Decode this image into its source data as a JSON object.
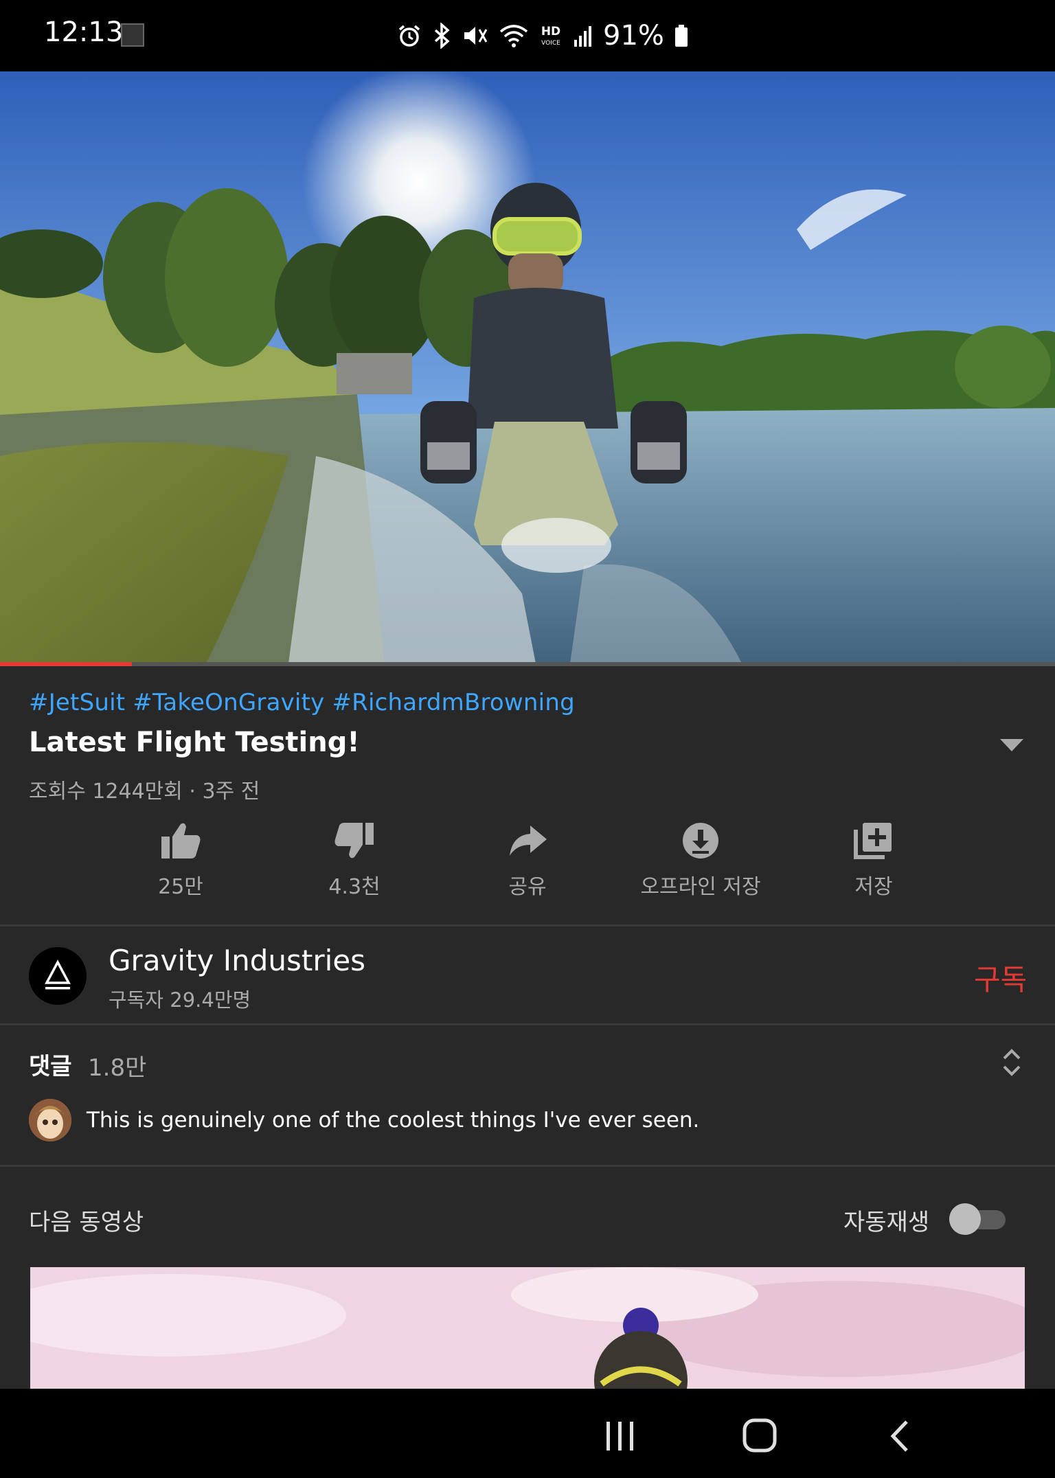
{
  "status_bar": {
    "time": "12:13",
    "battery": "91%",
    "icons": [
      "alarm-icon",
      "bluetooth-icon",
      "mute-icon",
      "wifi-icon",
      "hd-voice-icon",
      "signal-icon",
      "battery-icon"
    ],
    "hd_voice_top": "HD",
    "hd_voice_bottom": "VOICE"
  },
  "player": {
    "progress_fraction": 0.125,
    "progress_color": "#e53935"
  },
  "video": {
    "hashtags": "#JetSuit #TakeOnGravity #RichardmBrowning",
    "title": "Latest Flight Testing!",
    "meta": "조회수 1244만회 · 3주 전"
  },
  "actions": [
    {
      "icon": "thumbs-up-icon",
      "label": "25만"
    },
    {
      "icon": "thumbs-down-icon",
      "label": "4.3천"
    },
    {
      "icon": "share-icon",
      "label": "공유"
    },
    {
      "icon": "download-icon",
      "label": "오프라인 저장"
    },
    {
      "icon": "add-to-playlist-icon",
      "label": "저장"
    }
  ],
  "channel": {
    "name": "Gravity Industries",
    "subscribers": "구독자 29.4만명",
    "subscribe_label": "구독",
    "subscribe_color": "#e53935"
  },
  "comments": {
    "label": "댓글",
    "count": "1.8만",
    "top_comment": "This is genuinely one of the coolest things I've ever seen."
  },
  "up_next": {
    "label": "다음 동영상",
    "autoplay_label": "자동재생",
    "autoplay_on": false
  },
  "colors": {
    "background": "#282828",
    "hashtag": "#3ea6ff",
    "secondary_text": "#aaaaaa"
  }
}
